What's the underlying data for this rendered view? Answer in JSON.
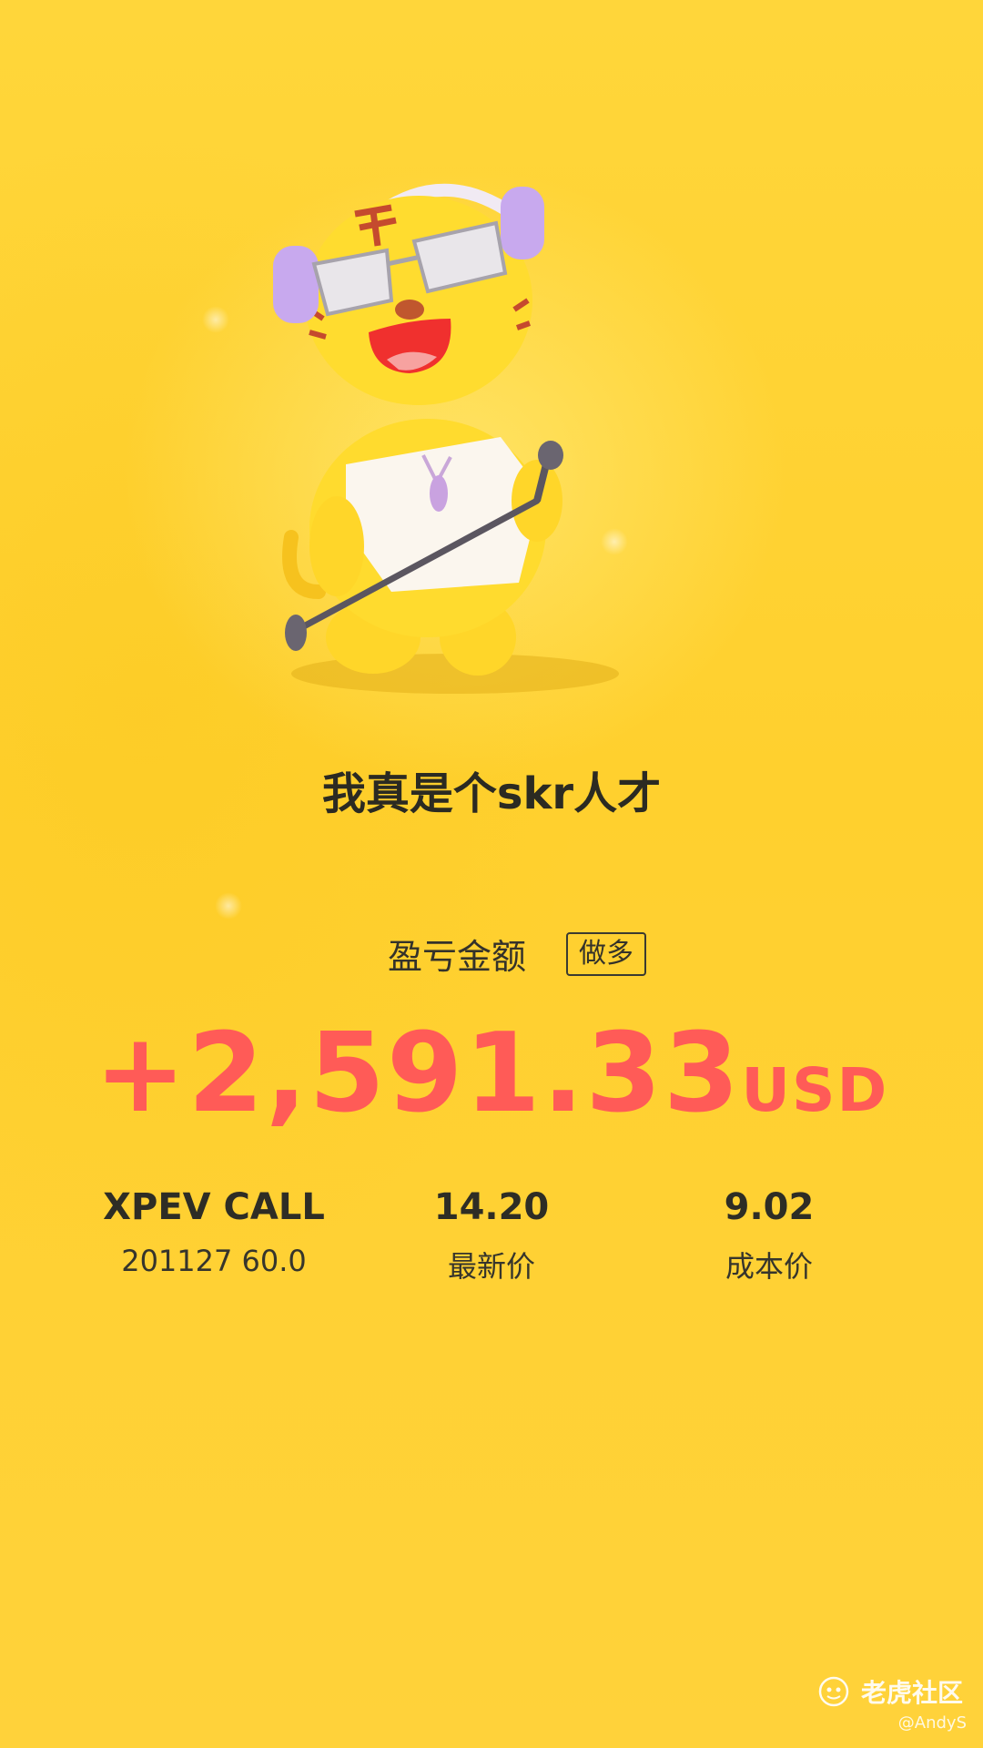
{
  "header": {
    "headline": "我真是个skr人才"
  },
  "pnl": {
    "label": "盈亏金额",
    "direction_badge": "做多",
    "amount": "+2,591.33",
    "unit": "USD"
  },
  "position": {
    "symbol": "XPEV CALL",
    "contract": "201127 60.0",
    "last_price_value": "14.20",
    "last_price_label": "最新价",
    "cost_value": "9.02",
    "cost_label": "成本价"
  },
  "watermark": {
    "brand": "老虎社区",
    "user": "@AndyS"
  },
  "colors": {
    "background": "#FFD534",
    "profit": "#FF5B57",
    "text": "#2b2a22"
  },
  "icons": {
    "mascot": "tiger-mascot-singing",
    "brand": "tiger-logo-icon"
  }
}
